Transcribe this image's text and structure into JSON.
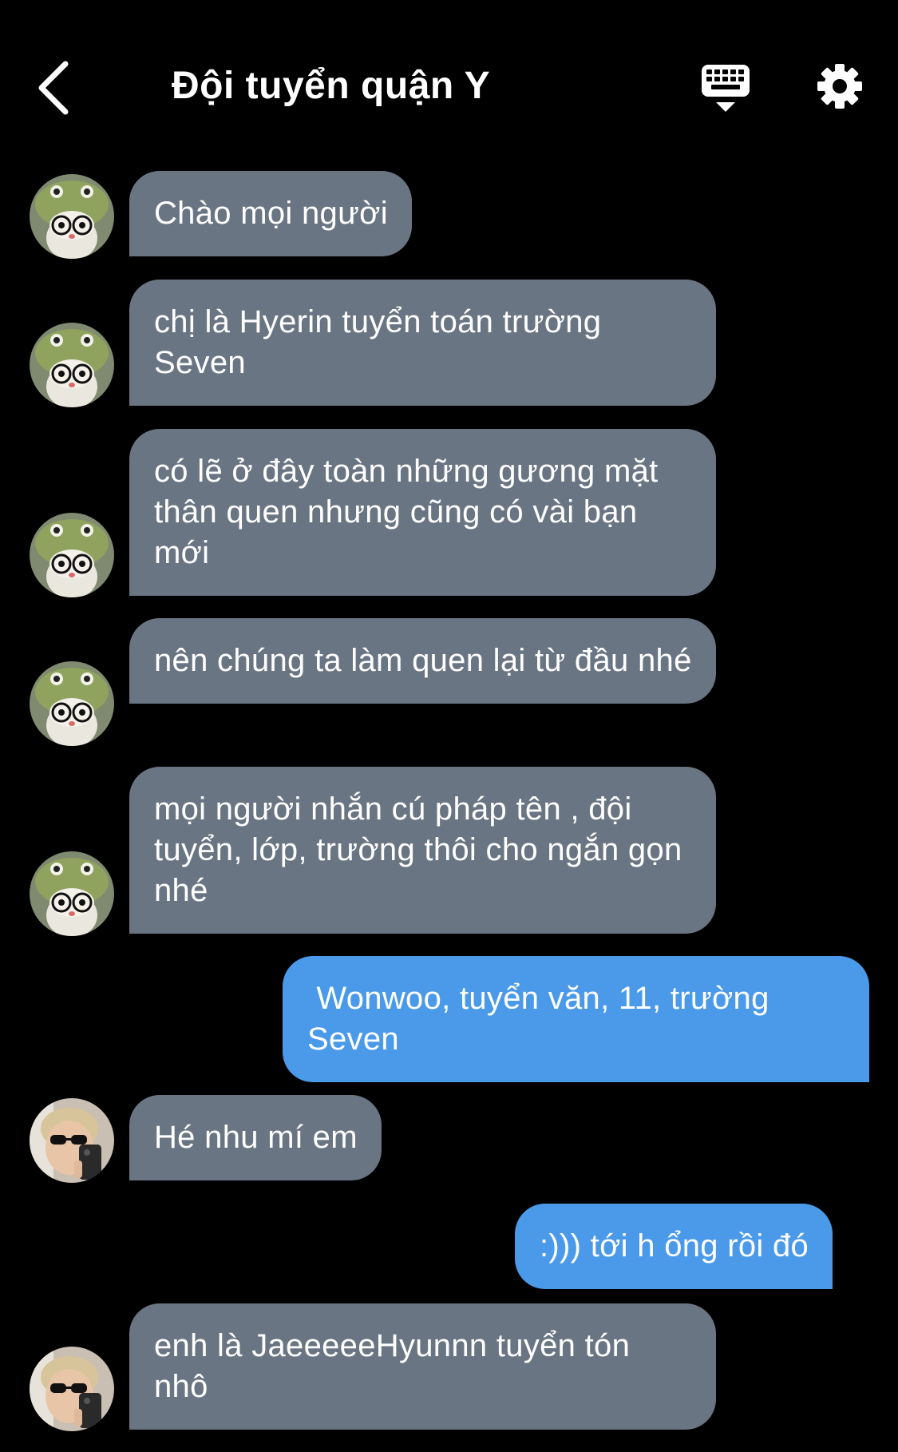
{
  "header": {
    "title": "Đội tuyển quận Y",
    "back_icon": "chevron-left-icon",
    "keyboard_icon": "keyboard-icon",
    "settings_icon": "gear-icon"
  },
  "colors": {
    "background": "#000000",
    "incoming_bubble": "#6a7583",
    "outgoing_bubble": "#4a9ae9",
    "text": "#ffffff"
  },
  "messages": [
    {
      "direction": "in",
      "sender": "Hyerin",
      "avatar": "frog-hat-plush-avatar",
      "text": "Chào mọi người"
    },
    {
      "direction": "in",
      "sender": "Hyerin",
      "avatar": "frog-hat-plush-avatar",
      "text": "chị là Hyerin tuyển toán trường Seven"
    },
    {
      "direction": "in",
      "sender": "Hyerin",
      "avatar": "frog-hat-plush-avatar",
      "text": "có lẽ ở đây toàn những gương mặt thân quen nhưng cũng có vài bạn mới"
    },
    {
      "direction": "in",
      "sender": "Hyerin",
      "avatar": "frog-hat-plush-avatar",
      "text": "nên chúng ta làm quen lại từ đầu nhé"
    },
    {
      "direction": "in",
      "sender": "Hyerin",
      "avatar": "frog-hat-plush-avatar",
      "text": "mọi người nhắn cú pháp tên , đội tuyển, lớp, trường thôi cho ngắn gọn nhé"
    },
    {
      "direction": "out",
      "text": " Wonwoo, tuyển văn, 11, trường Seven"
    },
    {
      "direction": "in",
      "sender": "JaeeeeeHyunnn",
      "avatar": "sunglasses-selfie-avatar",
      "text": "Hé nhu mí em"
    },
    {
      "direction": "out",
      "text": ":))) tới h ổng rồi đó"
    },
    {
      "direction": "in",
      "sender": "JaeeeeeHyunnn",
      "avatar": "sunglasses-selfie-avatar",
      "text": "enh là JaeeeeeHyunnn tuyển tón nhô"
    }
  ]
}
